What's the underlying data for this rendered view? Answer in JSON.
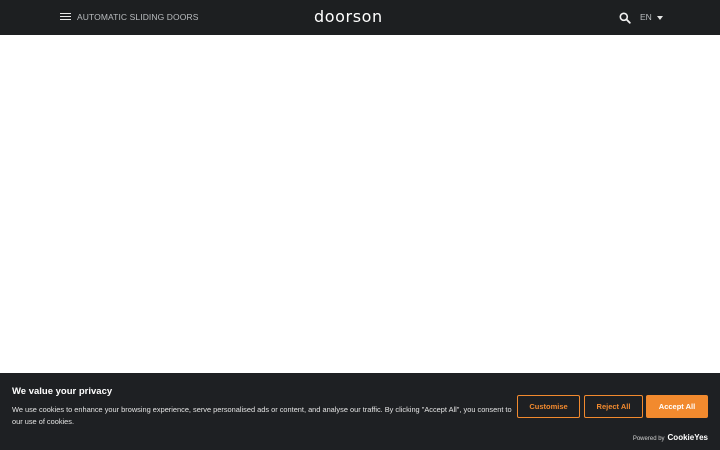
{
  "header": {
    "category": "AUTOMATIC SLIDING DOORS",
    "logo_text": "doorson",
    "language": "EN",
    "background": "#1d1f21"
  },
  "cookie_banner": {
    "title": "We value your privacy",
    "text": "We use cookies to enhance your browsing experience, serve personalised ads or content, and analyse our traffic. By clicking \"Accept All\", you consent to our use of cookies.",
    "customise_label": "Customise",
    "reject_label": "Reject All",
    "accept_label": "Accept All",
    "powered_by": "Powered by",
    "brand": "CookieYes",
    "accent_color": "#f28a2e",
    "background": "#1e2023"
  },
  "icons": {
    "menu": "menu-icon",
    "search": "search-icon",
    "dropdown": "chevron-down-icon"
  }
}
